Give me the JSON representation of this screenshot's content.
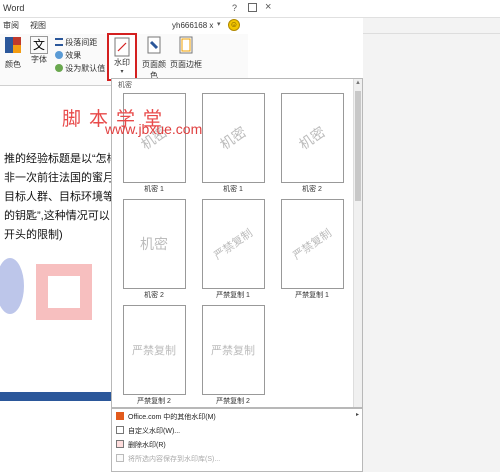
{
  "window": {
    "title": "Word",
    "help": "?",
    "close": "×"
  },
  "tabs": {
    "review": "审阅",
    "view": "视图"
  },
  "user": {
    "name": "yh666168 x",
    "caret": "▾",
    "avatar_glyph": "☺"
  },
  "ribbon": {
    "color_label": "颜色",
    "font_label": "字体",
    "font_icon_glyph": "文",
    "paragraph_spacing": "段落间距",
    "effects": "效果",
    "set_default": "设为默认值",
    "watermark": "水印",
    "page_color": "页面颜色",
    "page_border": "页面边框"
  },
  "document": {
    "site_title": "脚本学堂",
    "site_url": "www.jbxue.com",
    "lines": [
      "推的经验标题是以“怎样",
      "非一次前往法国的蜜月旅",
      "目标人群、目标环境等",
      "的钥匙”,这种情况可以",
      "开头的限制)"
    ]
  },
  "gallery": {
    "header": "机密",
    "items": [
      {
        "label": "机密 1",
        "watermark": "机密",
        "style": "diagonal"
      },
      {
        "label": "机密 1",
        "watermark": "机密",
        "style": "diagonal"
      },
      {
        "label": "机密 2",
        "watermark": "机密",
        "style": "diagonal"
      },
      {
        "label": "机密 2",
        "watermark": "机密",
        "style": "horizontal"
      },
      {
        "label": "严禁复制 1",
        "watermark": "严禁复制",
        "style": "diagonal"
      },
      {
        "label": "严禁复制 1",
        "watermark": "严禁复制",
        "style": "diagonal"
      },
      {
        "label": "严禁复制 2",
        "watermark": "严禁复制",
        "style": "horizontal"
      },
      {
        "label": "严禁复制 2",
        "watermark": "严禁复制",
        "style": "horizontal"
      }
    ]
  },
  "menu": {
    "items": [
      {
        "label": "Office.com 中的其他水印(M)",
        "icon": "office-icon",
        "disabled": false
      },
      {
        "label": "自定义水印(W)...",
        "icon": "custom-watermark-icon",
        "disabled": false
      },
      {
        "label": "删除水印(R)",
        "icon": "remove-watermark-icon",
        "disabled": false
      },
      {
        "label": "将所选内容保存到水印库(S)...",
        "icon": "save-to-gallery-icon",
        "disabled": true
      }
    ],
    "submenu_arrow": "▸"
  },
  "colors": {
    "accent": "#2b579a",
    "highlight_border": "#d42020",
    "site_red": "#e04040"
  }
}
